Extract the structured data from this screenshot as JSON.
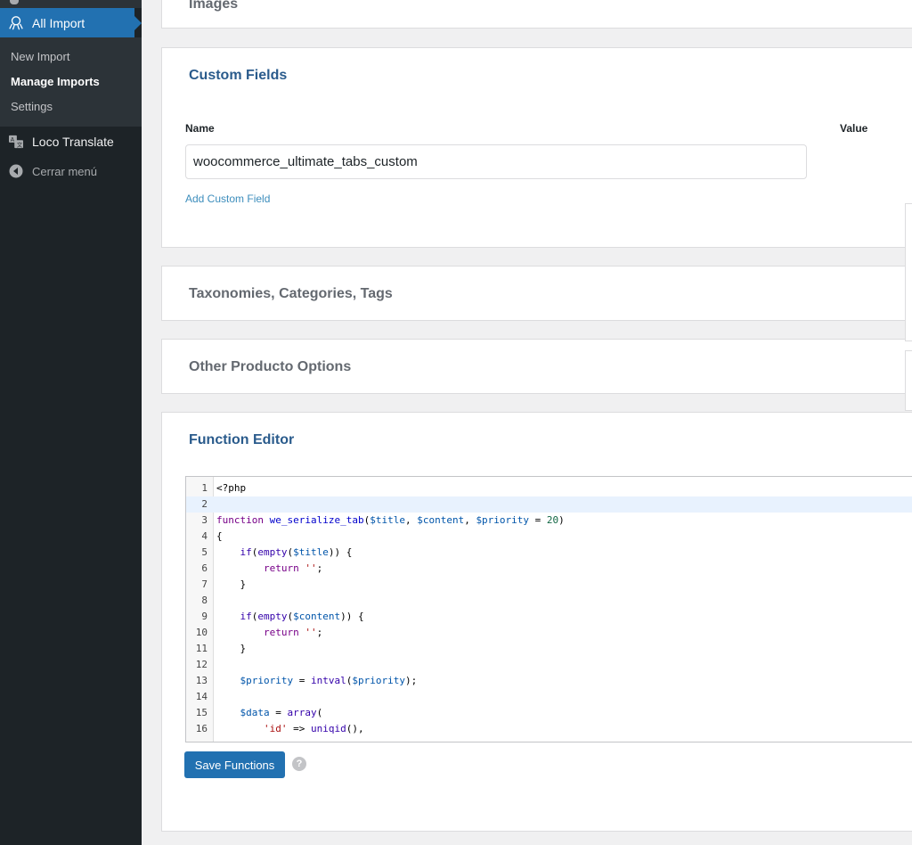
{
  "sidebar": {
    "active_menu": "All Import",
    "submenu": [
      {
        "label": "New Import",
        "current": false
      },
      {
        "label": "Manage Imports",
        "current": true
      },
      {
        "label": "Settings",
        "current": false
      }
    ],
    "items": [
      {
        "label": "Loco Translate",
        "icon": "translate-icon"
      },
      {
        "label": "Cerrar menú",
        "icon": "collapse-arrow-icon"
      }
    ]
  },
  "panels": {
    "images": {
      "title": "Images"
    },
    "custom_fields": {
      "title": "Custom Fields",
      "name_label": "Name",
      "value_label": "Value",
      "name_value": "woocommerce_ultimate_tabs_custom",
      "add_link": "Add Custom Field"
    },
    "taxonomies": {
      "title": "Taxonomies, Categories, Tags"
    },
    "other_options": {
      "title": "Other Producto Options"
    },
    "function_editor": {
      "title": "Function Editor",
      "save_button": "Save Functions",
      "help_symbol": "?",
      "lines": [
        {
          "n": "1",
          "text": "<?php"
        },
        {
          "n": "2",
          "text": ""
        },
        {
          "n": "3",
          "text": "function we_serialize_tab($title, $content, $priority = 20)"
        },
        {
          "n": "4",
          "text": "{"
        },
        {
          "n": "5",
          "text": "    if(empty($title)) {"
        },
        {
          "n": "6",
          "text": "        return '';"
        },
        {
          "n": "7",
          "text": "    }"
        },
        {
          "n": "8",
          "text": ""
        },
        {
          "n": "9",
          "text": "    if(empty($content)) {"
        },
        {
          "n": "10",
          "text": "        return '';"
        },
        {
          "n": "11",
          "text": "    }"
        },
        {
          "n": "12",
          "text": ""
        },
        {
          "n": "13",
          "text": "    $priority = intval($priority);"
        },
        {
          "n": "14",
          "text": ""
        },
        {
          "n": "15",
          "text": "    $data = array("
        },
        {
          "n": "16",
          "text": "        'id' => uniqid(),"
        }
      ]
    }
  },
  "colors": {
    "sidebar_bg": "#1d2327",
    "accent": "#2271b1",
    "title_blue": "#2a5b8c",
    "link": "#3c8dbc"
  }
}
